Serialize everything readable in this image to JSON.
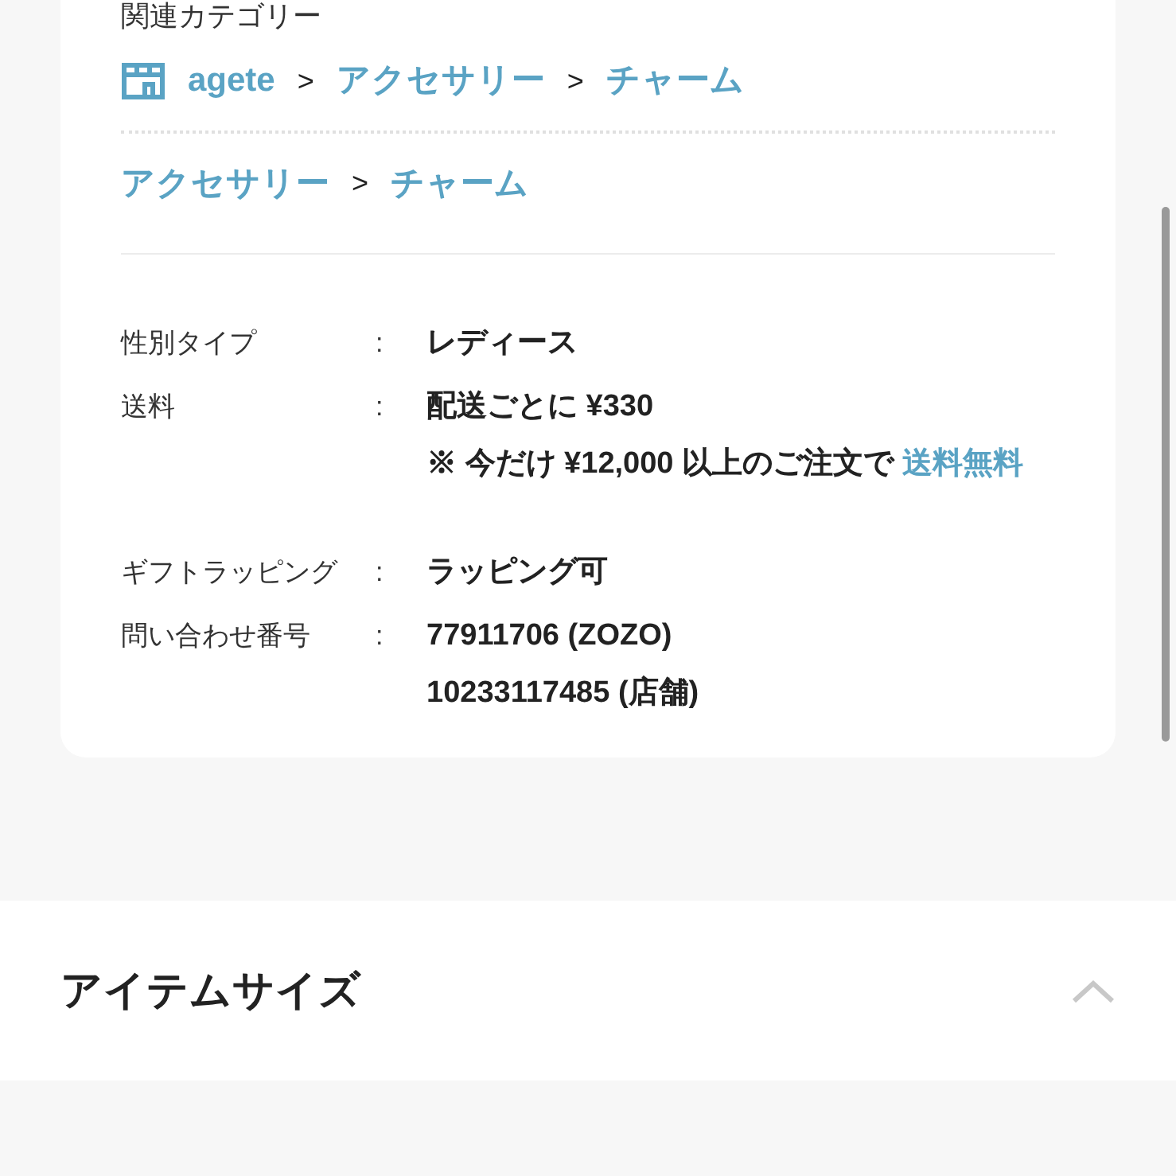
{
  "related_categories": {
    "heading": "関連カテゴリー",
    "paths": [
      {
        "segments": [
          {
            "kind": "shop",
            "text": "agete"
          },
          {
            "kind": "category",
            "text": "アクセサリー"
          },
          {
            "kind": "category",
            "text": "チャーム"
          }
        ]
      },
      {
        "segments": [
          {
            "kind": "category",
            "text": "アクセサリー"
          },
          {
            "kind": "category",
            "text": "チャーム"
          }
        ]
      }
    ],
    "separator": ">"
  },
  "details": [
    {
      "label": "性別タイプ",
      "lines": [
        [
          {
            "text": "レディース",
            "link": false
          }
        ]
      ]
    },
    {
      "label": "送料",
      "lines": [
        [
          {
            "text": "配送ごとに ¥330",
            "link": false
          }
        ],
        [
          {
            "text": "※ 今だけ ¥12,000 以上のご注文で ",
            "link": false
          },
          {
            "text": "送料無料",
            "link": true
          }
        ]
      ]
    },
    {
      "label": "ギフトラッピング",
      "lines": [
        [
          {
            "text": "ラッピング可",
            "link": false
          }
        ]
      ]
    },
    {
      "label": "問い合わせ番号",
      "lines": [
        [
          {
            "text": "77911706 (ZOZO)",
            "link": false
          }
        ],
        [
          {
            "text": "10233117485 (店舗)",
            "link": false
          }
        ]
      ]
    }
  ],
  "detail_separator": ":",
  "accordion": {
    "title": "アイテムサイズ",
    "expanded": true
  }
}
